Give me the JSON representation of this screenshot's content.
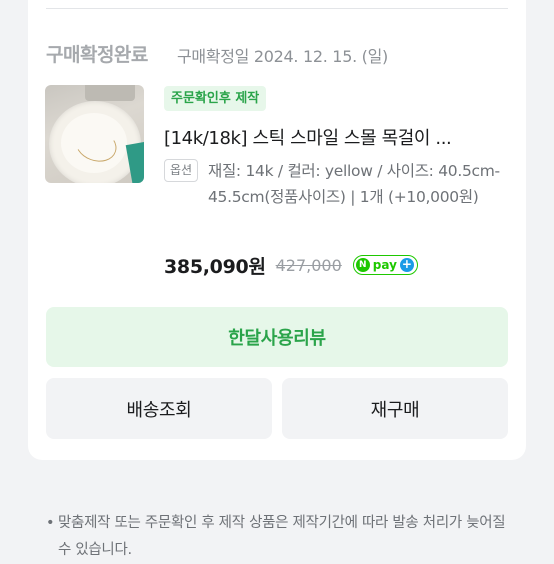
{
  "order": {
    "status": "구매확정완료",
    "confirm_date": "구매확정일 2024. 12. 15. (일)"
  },
  "product": {
    "tag": "주문확인후 제작",
    "title": "[14k/18k] 스틱 스마일 스몰 목걸이 ...",
    "option_label": "옵션",
    "option_text": "재질: 14k / 컬러: yellow / 사이즈: 40.5cm-45.5cm(정품사이즈) | 1개 (+10,000원)",
    "price": "385,090원",
    "original_price": "427,000",
    "npay_label": "pay"
  },
  "actions": {
    "review": "한달사용리뷰",
    "shipping": "배송조회",
    "reorder": "재구매"
  },
  "notice": {
    "bullet": "•",
    "text": "맞춤제작 또는 주문확인 후 제작 상품은 제작기간에 따라 발송 처리가 늦어질 수 있습니다."
  },
  "colors": {
    "accent_green": "#2aa44a",
    "npay_green": "#1ec800",
    "npay_blue": "#1a9be6"
  }
}
